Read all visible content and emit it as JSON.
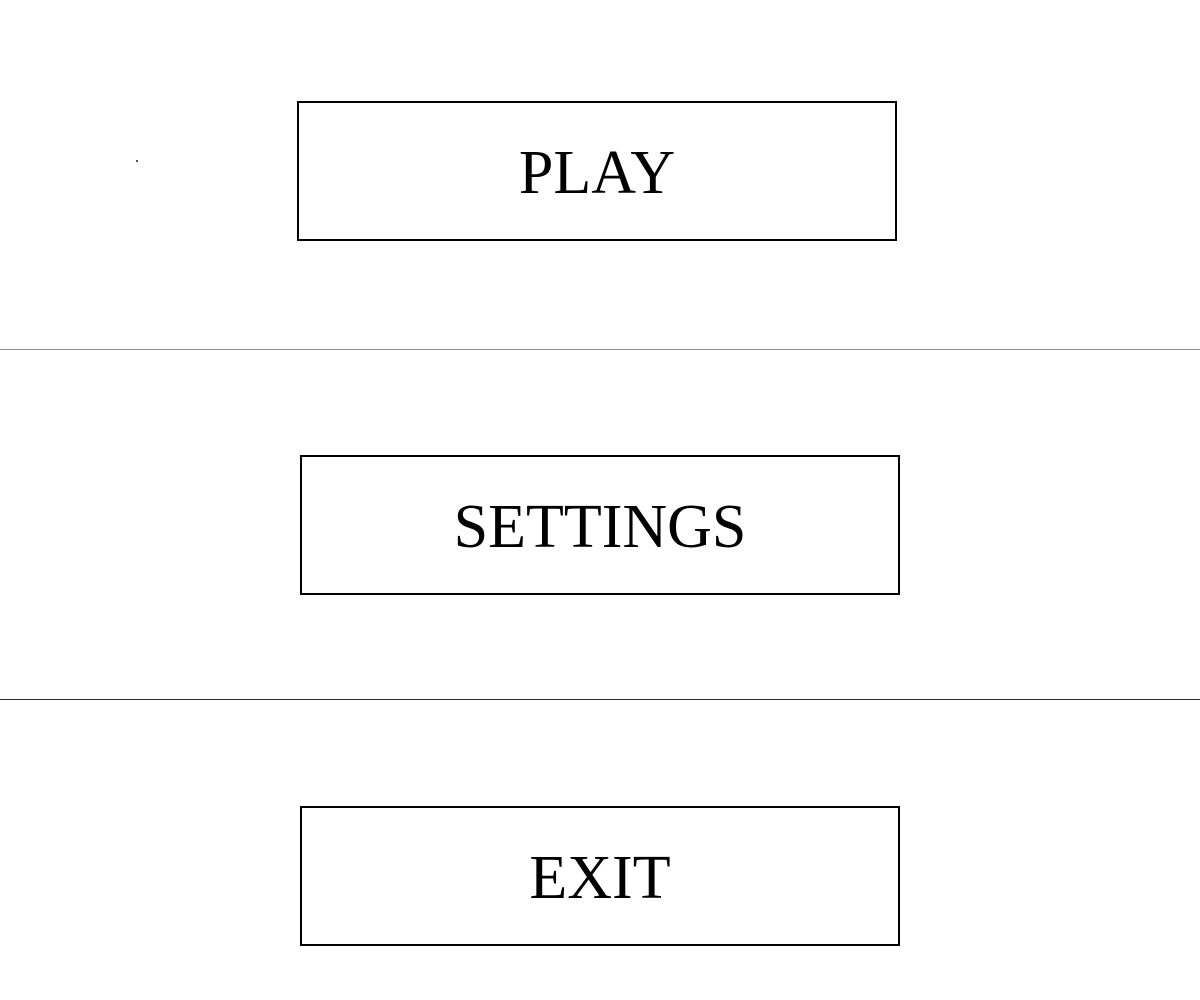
{
  "menu": {
    "play_label": "PLAY",
    "settings_label": "SETTINGS",
    "exit_label": "EXIT"
  },
  "colors": {
    "background": "#ffffff",
    "button_border": "#000000",
    "text": "#000000",
    "divider_light": "#8c8c8c",
    "divider_dark": "#2b2b2b"
  }
}
